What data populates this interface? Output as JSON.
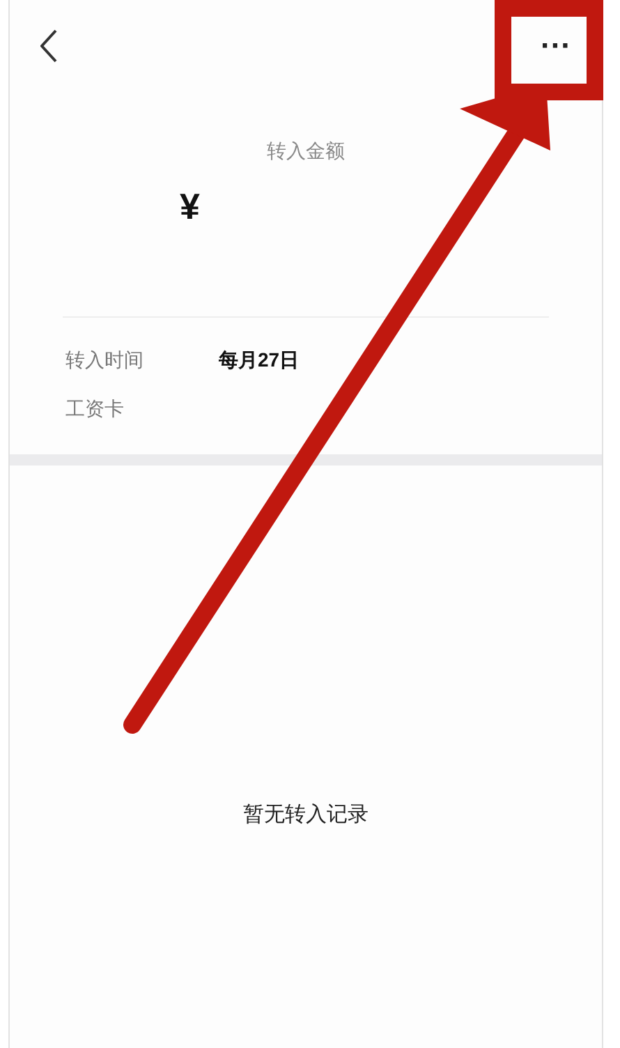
{
  "header": {
    "menu_glyph": "···"
  },
  "amount": {
    "label": "转入金额",
    "currency": "¥"
  },
  "details": [
    {
      "label": "转入时间",
      "value": "每月27日"
    },
    {
      "label": "工资卡"
    }
  ],
  "empty_state": "暂无转入记录"
}
